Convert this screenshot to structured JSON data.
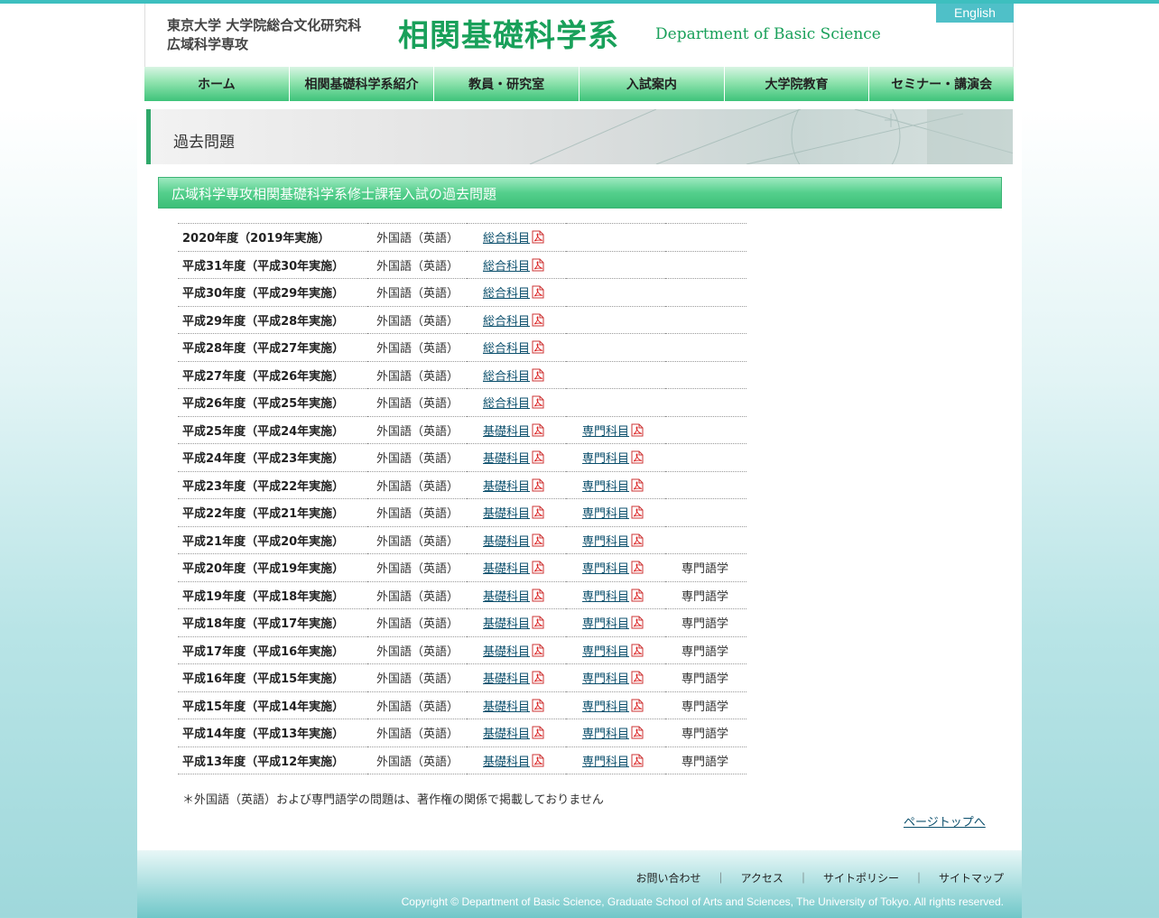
{
  "header": {
    "univ_line1": "東京大学 大学院総合文化研究科",
    "univ_line2": "広域科学専攻",
    "logo_jp": "相関基礎科学系",
    "logo_en": "Department of Basic Science",
    "english_label": "English"
  },
  "nav": [
    {
      "label": "ホーム"
    },
    {
      "label": "相関基礎科学系紹介"
    },
    {
      "label": "教員・研究室"
    },
    {
      "label": "入試案内"
    },
    {
      "label": "大学院教育"
    },
    {
      "label": "セミナー・講演会"
    }
  ],
  "page_title": "過去問題",
  "section_heading": "広域科学専攻相関基礎科学系修士課程入試の過去問題",
  "rows": [
    {
      "year": "2020年度（2019年実施）",
      "lang": "外国語（英語）",
      "link1": "総合科目",
      "link2": "",
      "extra": ""
    },
    {
      "year": "平成31年度（平成30年実施）",
      "lang": "外国語（英語）",
      "link1": "総合科目",
      "link2": "",
      "extra": ""
    },
    {
      "year": "平成30年度（平成29年実施）",
      "lang": "外国語（英語）",
      "link1": "総合科目",
      "link2": "",
      "extra": ""
    },
    {
      "year": "平成29年度（平成28年実施）",
      "lang": "外国語（英語）",
      "link1": "総合科目",
      "link2": "",
      "extra": ""
    },
    {
      "year": "平成28年度（平成27年実施）",
      "lang": "外国語（英語）",
      "link1": "総合科目",
      "link2": "",
      "extra": ""
    },
    {
      "year": "平成27年度（平成26年実施）",
      "lang": "外国語（英語）",
      "link1": "総合科目",
      "link2": "",
      "extra": ""
    },
    {
      "year": "平成26年度（平成25年実施）",
      "lang": "外国語（英語）",
      "link1": "総合科目",
      "link2": "",
      "extra": ""
    },
    {
      "year": "平成25年度（平成24年実施）",
      "lang": "外国語（英語）",
      "link1": "基礎科目",
      "link2": "専門科目",
      "extra": ""
    },
    {
      "year": "平成24年度（平成23年実施）",
      "lang": "外国語（英語）",
      "link1": "基礎科目",
      "link2": "専門科目",
      "extra": ""
    },
    {
      "year": "平成23年度（平成22年実施）",
      "lang": "外国語（英語）",
      "link1": "基礎科目",
      "link2": "専門科目",
      "extra": ""
    },
    {
      "year": "平成22年度（平成21年実施）",
      "lang": "外国語（英語）",
      "link1": "基礎科目",
      "link2": "専門科目",
      "extra": ""
    },
    {
      "year": "平成21年度（平成20年実施）",
      "lang": "外国語（英語）",
      "link1": "基礎科目",
      "link2": "専門科目",
      "extra": ""
    },
    {
      "year": "平成20年度（平成19年実施）",
      "lang": "外国語（英語）",
      "link1": "基礎科目",
      "link2": "専門科目",
      "extra": "専門語学"
    },
    {
      "year": "平成19年度（平成18年実施）",
      "lang": "外国語（英語）",
      "link1": "基礎科目",
      "link2": "専門科目",
      "extra": "専門語学"
    },
    {
      "year": "平成18年度（平成17年実施）",
      "lang": "外国語（英語）",
      "link1": "基礎科目",
      "link2": "専門科目",
      "extra": "専門語学"
    },
    {
      "year": "平成17年度（平成16年実施）",
      "lang": "外国語（英語）",
      "link1": "基礎科目",
      "link2": "専門科目",
      "extra": "専門語学"
    },
    {
      "year": "平成16年度（平成15年実施）",
      "lang": "外国語（英語）",
      "link1": "基礎科目",
      "link2": "専門科目",
      "extra": "専門語学"
    },
    {
      "year": "平成15年度（平成14年実施）",
      "lang": "外国語（英語）",
      "link1": "基礎科目",
      "link2": "専門科目",
      "extra": "専門語学"
    },
    {
      "year": "平成14年度（平成13年実施）",
      "lang": "外国語（英語）",
      "link1": "基礎科目",
      "link2": "専門科目",
      "extra": "専門語学"
    },
    {
      "year": "平成13年度（平成12年実施）",
      "lang": "外国語（英語）",
      "link1": "基礎科目",
      "link2": "専門科目",
      "extra": "専門語学"
    }
  ],
  "note": "＊外国語（英語）および専門語学の問題は、著作権の関係で掲載しておりません",
  "pagetop": "ページトップへ",
  "footer": {
    "links": [
      "お問い合わせ",
      "アクセス",
      "サイトポリシー",
      "サイトマップ"
    ],
    "separator": "｜",
    "copyright": "Copyright © Department of Basic Science, Graduate School of Arts and Sciences, The University of Tokyo. All rights reserved."
  },
  "colors": {
    "accent_green": "#19a05a",
    "teal": "#4fc0c8",
    "link": "#0b4f6c"
  },
  "icons": {
    "pdf": "pdf-icon"
  }
}
